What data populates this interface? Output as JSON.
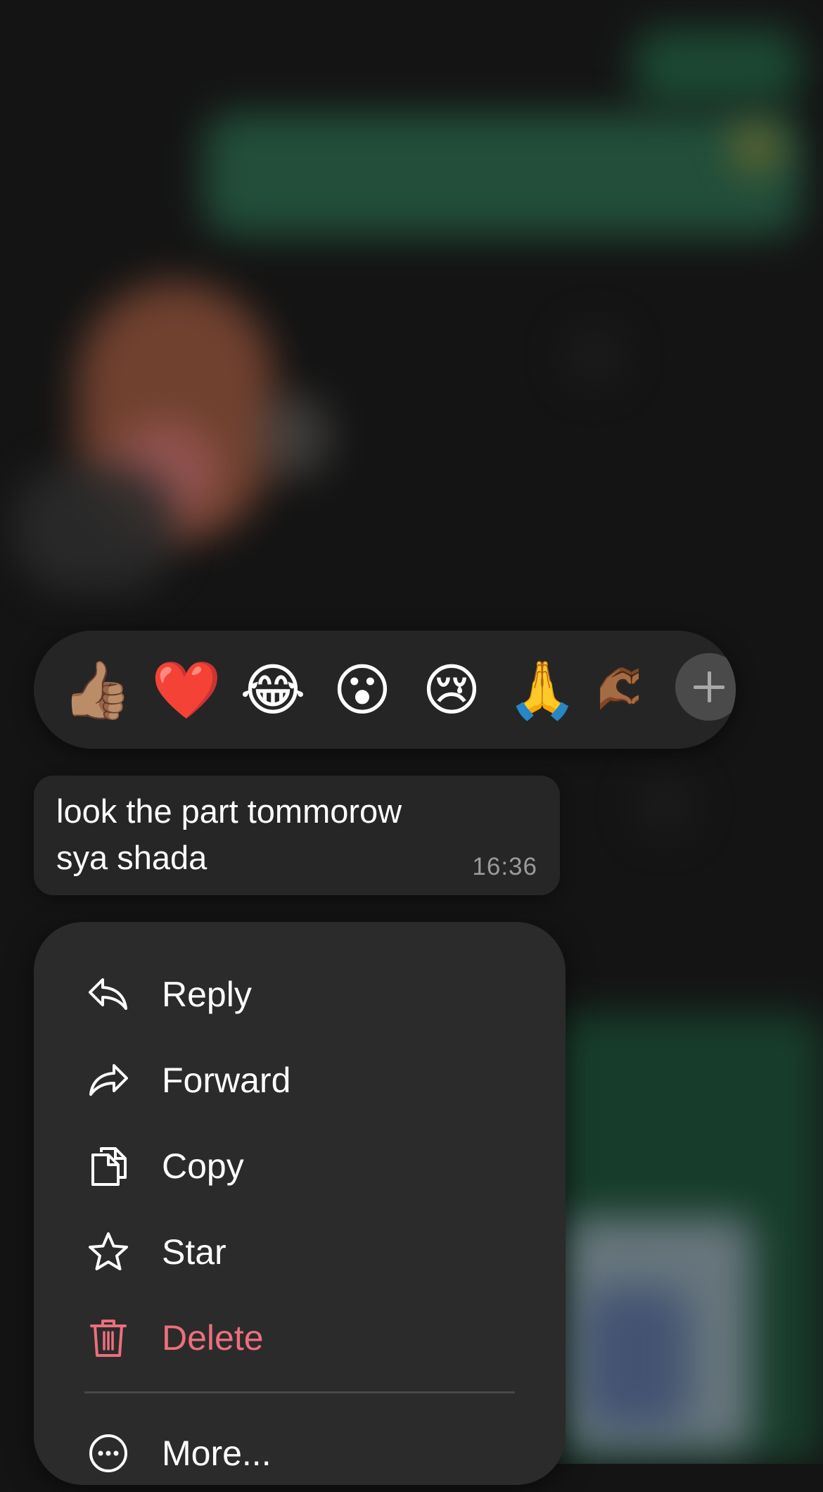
{
  "reactions": {
    "emojis": [
      {
        "name": "thumbs-up-medium-skin-emoji",
        "char": "👍🏽"
      },
      {
        "name": "red-heart-emoji",
        "char": "❤️"
      },
      {
        "name": "tears-of-joy-emoji",
        "char": "😂"
      },
      {
        "name": "surprised-face-emoji",
        "char": "😮"
      },
      {
        "name": "crying-face-emoji",
        "char": "😢"
      },
      {
        "name": "folded-hands-emoji",
        "char": "🙏"
      },
      {
        "name": "heart-hands-emoji",
        "char": "🫶🏾"
      }
    ],
    "add_icon": "plus-icon"
  },
  "message": {
    "text_line1": "look the part tommorow",
    "text_line2": "sya shada",
    "time": "16:36"
  },
  "menu": {
    "items": [
      {
        "label": "Reply",
        "icon": "reply-icon"
      },
      {
        "label": "Forward",
        "icon": "forward-icon"
      },
      {
        "label": "Copy",
        "icon": "copy-icon"
      },
      {
        "label": "Star",
        "icon": "star-icon"
      },
      {
        "label": "Delete",
        "icon": "trash-icon",
        "danger_color": "#ec6f7d"
      },
      {
        "label": "More...",
        "icon": "more-icon"
      }
    ]
  }
}
